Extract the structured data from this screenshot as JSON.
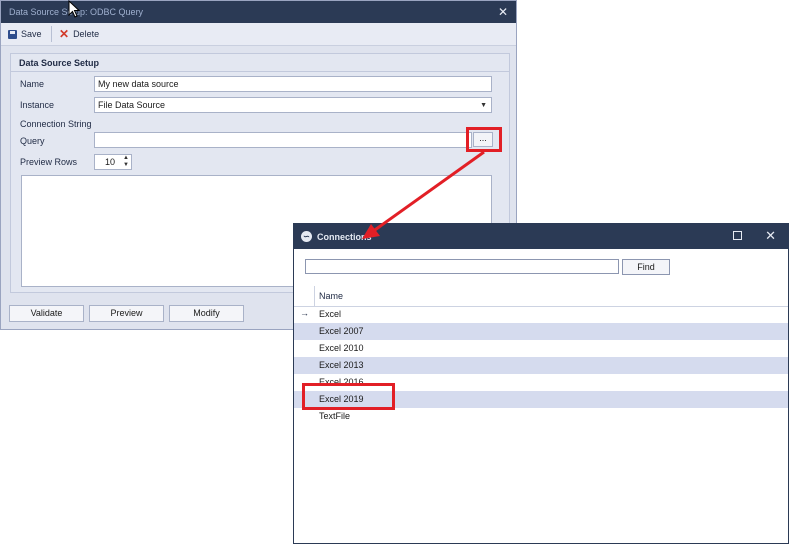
{
  "main_window": {
    "title": "Data Source Setup: ODBC Query",
    "toolbar": {
      "save": "Save",
      "delete": "Delete"
    },
    "group_title": "Data Source Setup",
    "fields": {
      "name_label": "Name",
      "name_value": "My new data source",
      "instance_label": "Instance",
      "instance_value": "File Data Source",
      "connection_string_label": "Connection String",
      "query_label": "Query",
      "query_value": "",
      "ellipsis": "...",
      "preview_rows_label": "Preview Rows",
      "preview_rows_value": "10"
    },
    "buttons": {
      "validate": "Validate",
      "preview": "Preview",
      "modify": "Modify"
    }
  },
  "connection_dialog": {
    "title": "Connections",
    "search_value": "",
    "find_button": "Find",
    "column_header": "Name",
    "current_row_indicator": "→",
    "rows": [
      "Excel",
      "Excel 2007",
      "Excel 2010",
      "Excel 2013",
      "Excel 2016",
      "Excel 2019",
      "TextFile"
    ]
  },
  "colors": {
    "titlebar": "#2b3a55",
    "highlight": "#e21f26",
    "alt_row": "#d5dbee"
  }
}
